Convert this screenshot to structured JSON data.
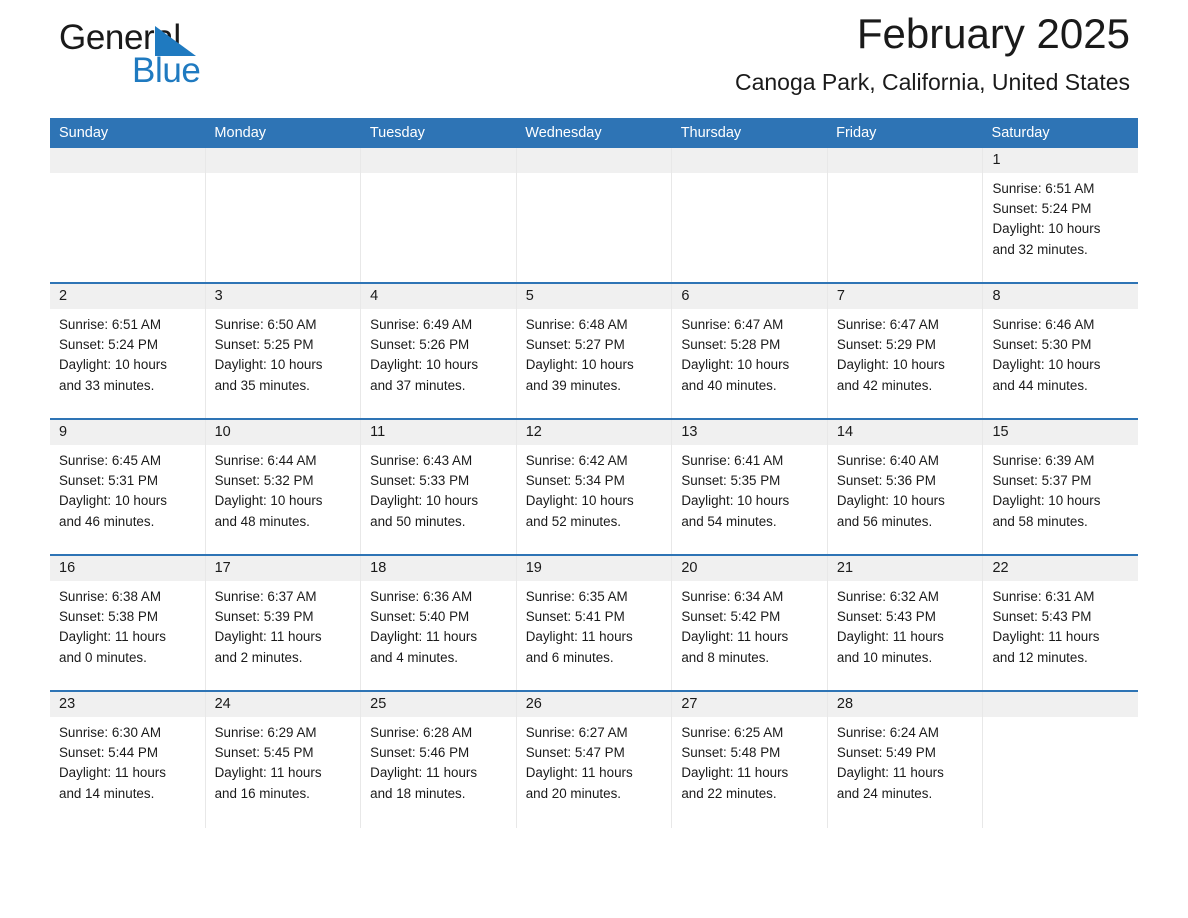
{
  "brand": {
    "word_one": "General",
    "word_two": "Blue",
    "triangle_color": "#1f7ac0",
    "blue_text_color": "#1f7ac0"
  },
  "header": {
    "title": "February 2025",
    "subtitle": "Canoga Park, California, United States"
  },
  "theme": {
    "header_blue": "#2e74b5",
    "row_divider_blue": "#2e74b5",
    "date_band_gray": "#f0f0f0",
    "cell_divider": "#e8e8e8"
  },
  "weekday_headers": [
    "Sunday",
    "Monday",
    "Tuesday",
    "Wednesday",
    "Thursday",
    "Friday",
    "Saturday"
  ],
  "weeks": [
    [
      {
        "day": "",
        "empty": true,
        "sunrise": "",
        "sunset": "",
        "daylight_line1": "",
        "daylight_line2": ""
      },
      {
        "day": "",
        "empty": true,
        "sunrise": "",
        "sunset": "",
        "daylight_line1": "",
        "daylight_line2": ""
      },
      {
        "day": "",
        "empty": true,
        "sunrise": "",
        "sunset": "",
        "daylight_line1": "",
        "daylight_line2": ""
      },
      {
        "day": "",
        "empty": true,
        "sunrise": "",
        "sunset": "",
        "daylight_line1": "",
        "daylight_line2": ""
      },
      {
        "day": "",
        "empty": true,
        "sunrise": "",
        "sunset": "",
        "daylight_line1": "",
        "daylight_line2": ""
      },
      {
        "day": "",
        "empty": true,
        "sunrise": "",
        "sunset": "",
        "daylight_line1": "",
        "daylight_line2": ""
      },
      {
        "day": "1",
        "empty": false,
        "sunrise": "Sunrise: 6:51 AM",
        "sunset": "Sunset: 5:24 PM",
        "daylight_line1": "Daylight: 10 hours",
        "daylight_line2": "and 32 minutes."
      }
    ],
    [
      {
        "day": "2",
        "empty": false,
        "sunrise": "Sunrise: 6:51 AM",
        "sunset": "Sunset: 5:24 PM",
        "daylight_line1": "Daylight: 10 hours",
        "daylight_line2": "and 33 minutes."
      },
      {
        "day": "3",
        "empty": false,
        "sunrise": "Sunrise: 6:50 AM",
        "sunset": "Sunset: 5:25 PM",
        "daylight_line1": "Daylight: 10 hours",
        "daylight_line2": "and 35 minutes."
      },
      {
        "day": "4",
        "empty": false,
        "sunrise": "Sunrise: 6:49 AM",
        "sunset": "Sunset: 5:26 PM",
        "daylight_line1": "Daylight: 10 hours",
        "daylight_line2": "and 37 minutes."
      },
      {
        "day": "5",
        "empty": false,
        "sunrise": "Sunrise: 6:48 AM",
        "sunset": "Sunset: 5:27 PM",
        "daylight_line1": "Daylight: 10 hours",
        "daylight_line2": "and 39 minutes."
      },
      {
        "day": "6",
        "empty": false,
        "sunrise": "Sunrise: 6:47 AM",
        "sunset": "Sunset: 5:28 PM",
        "daylight_line1": "Daylight: 10 hours",
        "daylight_line2": "and 40 minutes."
      },
      {
        "day": "7",
        "empty": false,
        "sunrise": "Sunrise: 6:47 AM",
        "sunset": "Sunset: 5:29 PM",
        "daylight_line1": "Daylight: 10 hours",
        "daylight_line2": "and 42 minutes."
      },
      {
        "day": "8",
        "empty": false,
        "sunrise": "Sunrise: 6:46 AM",
        "sunset": "Sunset: 5:30 PM",
        "daylight_line1": "Daylight: 10 hours",
        "daylight_line2": "and 44 minutes."
      }
    ],
    [
      {
        "day": "9",
        "empty": false,
        "sunrise": "Sunrise: 6:45 AM",
        "sunset": "Sunset: 5:31 PM",
        "daylight_line1": "Daylight: 10 hours",
        "daylight_line2": "and 46 minutes."
      },
      {
        "day": "10",
        "empty": false,
        "sunrise": "Sunrise: 6:44 AM",
        "sunset": "Sunset: 5:32 PM",
        "daylight_line1": "Daylight: 10 hours",
        "daylight_line2": "and 48 minutes."
      },
      {
        "day": "11",
        "empty": false,
        "sunrise": "Sunrise: 6:43 AM",
        "sunset": "Sunset: 5:33 PM",
        "daylight_line1": "Daylight: 10 hours",
        "daylight_line2": "and 50 minutes."
      },
      {
        "day": "12",
        "empty": false,
        "sunrise": "Sunrise: 6:42 AM",
        "sunset": "Sunset: 5:34 PM",
        "daylight_line1": "Daylight: 10 hours",
        "daylight_line2": "and 52 minutes."
      },
      {
        "day": "13",
        "empty": false,
        "sunrise": "Sunrise: 6:41 AM",
        "sunset": "Sunset: 5:35 PM",
        "daylight_line1": "Daylight: 10 hours",
        "daylight_line2": "and 54 minutes."
      },
      {
        "day": "14",
        "empty": false,
        "sunrise": "Sunrise: 6:40 AM",
        "sunset": "Sunset: 5:36 PM",
        "daylight_line1": "Daylight: 10 hours",
        "daylight_line2": "and 56 minutes."
      },
      {
        "day": "15",
        "empty": false,
        "sunrise": "Sunrise: 6:39 AM",
        "sunset": "Sunset: 5:37 PM",
        "daylight_line1": "Daylight: 10 hours",
        "daylight_line2": "and 58 minutes."
      }
    ],
    [
      {
        "day": "16",
        "empty": false,
        "sunrise": "Sunrise: 6:38 AM",
        "sunset": "Sunset: 5:38 PM",
        "daylight_line1": "Daylight: 11 hours",
        "daylight_line2": "and 0 minutes."
      },
      {
        "day": "17",
        "empty": false,
        "sunrise": "Sunrise: 6:37 AM",
        "sunset": "Sunset: 5:39 PM",
        "daylight_line1": "Daylight: 11 hours",
        "daylight_line2": "and 2 minutes."
      },
      {
        "day": "18",
        "empty": false,
        "sunrise": "Sunrise: 6:36 AM",
        "sunset": "Sunset: 5:40 PM",
        "daylight_line1": "Daylight: 11 hours",
        "daylight_line2": "and 4 minutes."
      },
      {
        "day": "19",
        "empty": false,
        "sunrise": "Sunrise: 6:35 AM",
        "sunset": "Sunset: 5:41 PM",
        "daylight_line1": "Daylight: 11 hours",
        "daylight_line2": "and 6 minutes."
      },
      {
        "day": "20",
        "empty": false,
        "sunrise": "Sunrise: 6:34 AM",
        "sunset": "Sunset: 5:42 PM",
        "daylight_line1": "Daylight: 11 hours",
        "daylight_line2": "and 8 minutes."
      },
      {
        "day": "21",
        "empty": false,
        "sunrise": "Sunrise: 6:32 AM",
        "sunset": "Sunset: 5:43 PM",
        "daylight_line1": "Daylight: 11 hours",
        "daylight_line2": "and 10 minutes."
      },
      {
        "day": "22",
        "empty": false,
        "sunrise": "Sunrise: 6:31 AM",
        "sunset": "Sunset: 5:43 PM",
        "daylight_line1": "Daylight: 11 hours",
        "daylight_line2": "and 12 minutes."
      }
    ],
    [
      {
        "day": "23",
        "empty": false,
        "sunrise": "Sunrise: 6:30 AM",
        "sunset": "Sunset: 5:44 PM",
        "daylight_line1": "Daylight: 11 hours",
        "daylight_line2": "and 14 minutes."
      },
      {
        "day": "24",
        "empty": false,
        "sunrise": "Sunrise: 6:29 AM",
        "sunset": "Sunset: 5:45 PM",
        "daylight_line1": "Daylight: 11 hours",
        "daylight_line2": "and 16 minutes."
      },
      {
        "day": "25",
        "empty": false,
        "sunrise": "Sunrise: 6:28 AM",
        "sunset": "Sunset: 5:46 PM",
        "daylight_line1": "Daylight: 11 hours",
        "daylight_line2": "and 18 minutes."
      },
      {
        "day": "26",
        "empty": false,
        "sunrise": "Sunrise: 6:27 AM",
        "sunset": "Sunset: 5:47 PM",
        "daylight_line1": "Daylight: 11 hours",
        "daylight_line2": "and 20 minutes."
      },
      {
        "day": "27",
        "empty": false,
        "sunrise": "Sunrise: 6:25 AM",
        "sunset": "Sunset: 5:48 PM",
        "daylight_line1": "Daylight: 11 hours",
        "daylight_line2": "and 22 minutes."
      },
      {
        "day": "28",
        "empty": false,
        "sunrise": "Sunrise: 6:24 AM",
        "sunset": "Sunset: 5:49 PM",
        "daylight_line1": "Daylight: 11 hours",
        "daylight_line2": "and 24 minutes."
      },
      {
        "day": "",
        "empty": true,
        "sunrise": "",
        "sunset": "",
        "daylight_line1": "",
        "daylight_line2": ""
      }
    ]
  ]
}
